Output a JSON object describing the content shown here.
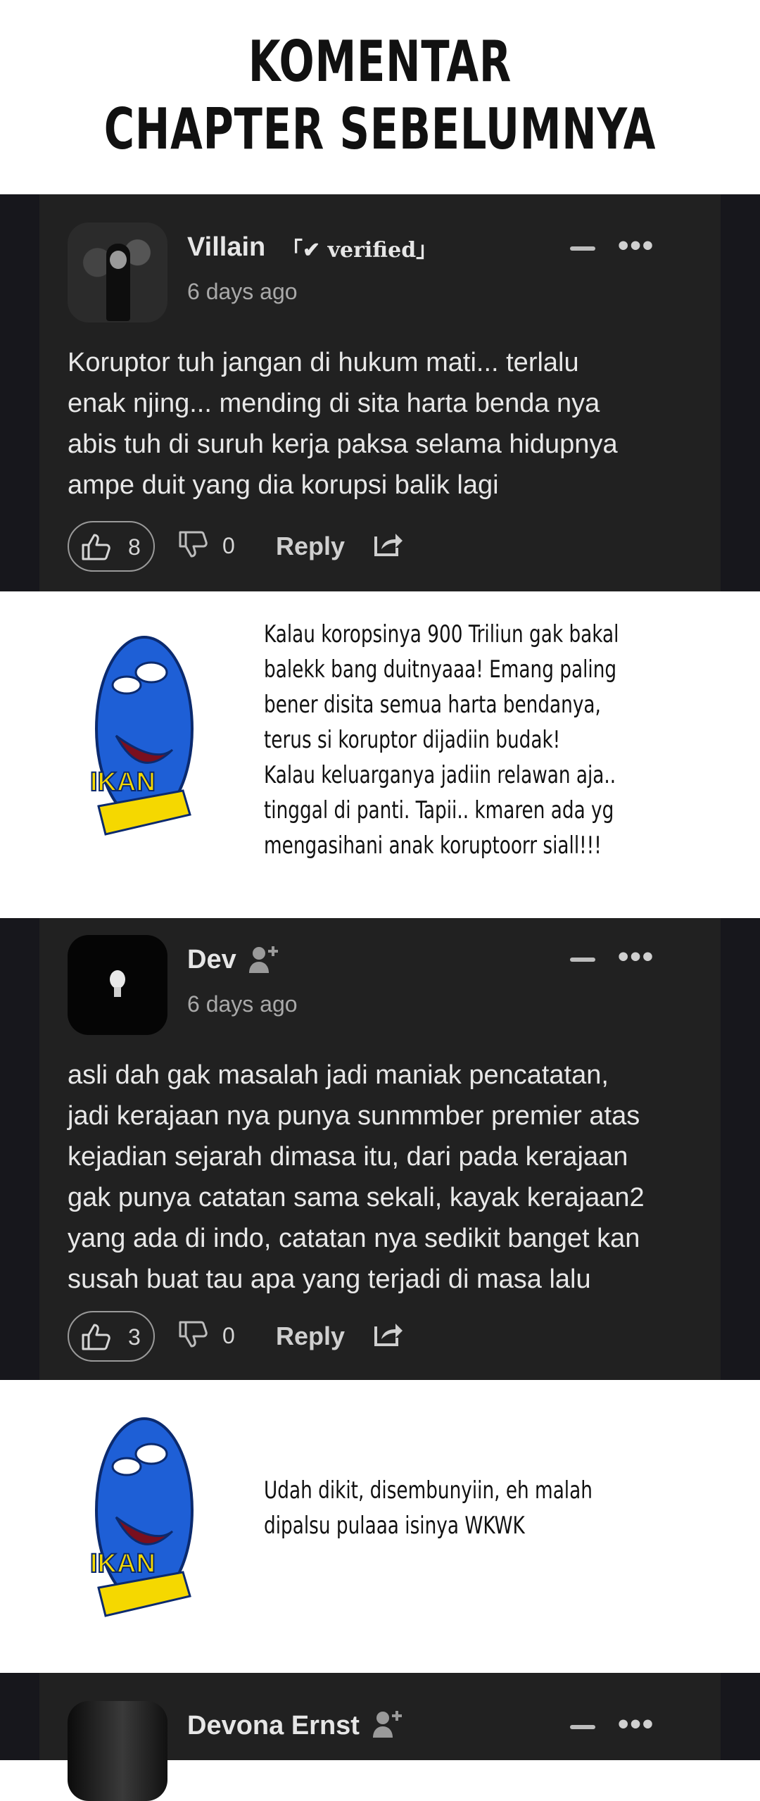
{
  "header": {
    "line1": "KOMENTAR",
    "line2": "CHAPTER SEBELUMNYA"
  },
  "comments": [
    {
      "name": "Villain",
      "badge": "「✔ verified」",
      "time": "6 days ago",
      "text": [
        "Koruptor tuh jangan di hukum mati... terlalu",
        "enak njing... mending di sita harta benda nya",
        "abis tuh di suruh kerja paksa selama hidupnya",
        "ampe duit yang dia korupsi balik lagi"
      ],
      "likes": "8",
      "dislikes": "0",
      "reply_label": "Reply"
    },
    {
      "name": "Dev",
      "time": "6 days ago",
      "text": [
        "asli dah gak masalah jadi maniak pencatatan,",
        "jadi kerajaan nya punya sunmmber premier atas",
        "kejadian sejarah dimasa itu, dari pada kerajaan",
        "gak punya catatan sama sekali, kayak kerajaan2",
        "yang ada di indo, catatan nya sedikit banget kan",
        "susah buat tau apa yang terjadi di masa lalu"
      ],
      "likes": "3",
      "dislikes": "0",
      "reply_label": "Reply"
    },
    {
      "name": "Devona Ernst"
    }
  ],
  "notes": [
    {
      "sticker_label": "IKAN",
      "lines": [
        "Kalau koropsinya 900 Triliun gak bakal",
        "balekk bang duitnyaaa! Emang paling",
        "bener disita semua harta bendanya,",
        "terus si koruptor dijadiin budak!",
        "Kalau keluarganya jadiin relawan aja..",
        "tinggal di panti. Tapii.. kmaren ada yg",
        "mengasihani anak koruptoorr siall!!!"
      ]
    },
    {
      "sticker_label": "IKAN",
      "lines": [
        "Udah dikit, disembunyiin, eh malah",
        "dipalsu pulaaa isinya WKWK"
      ]
    }
  ]
}
